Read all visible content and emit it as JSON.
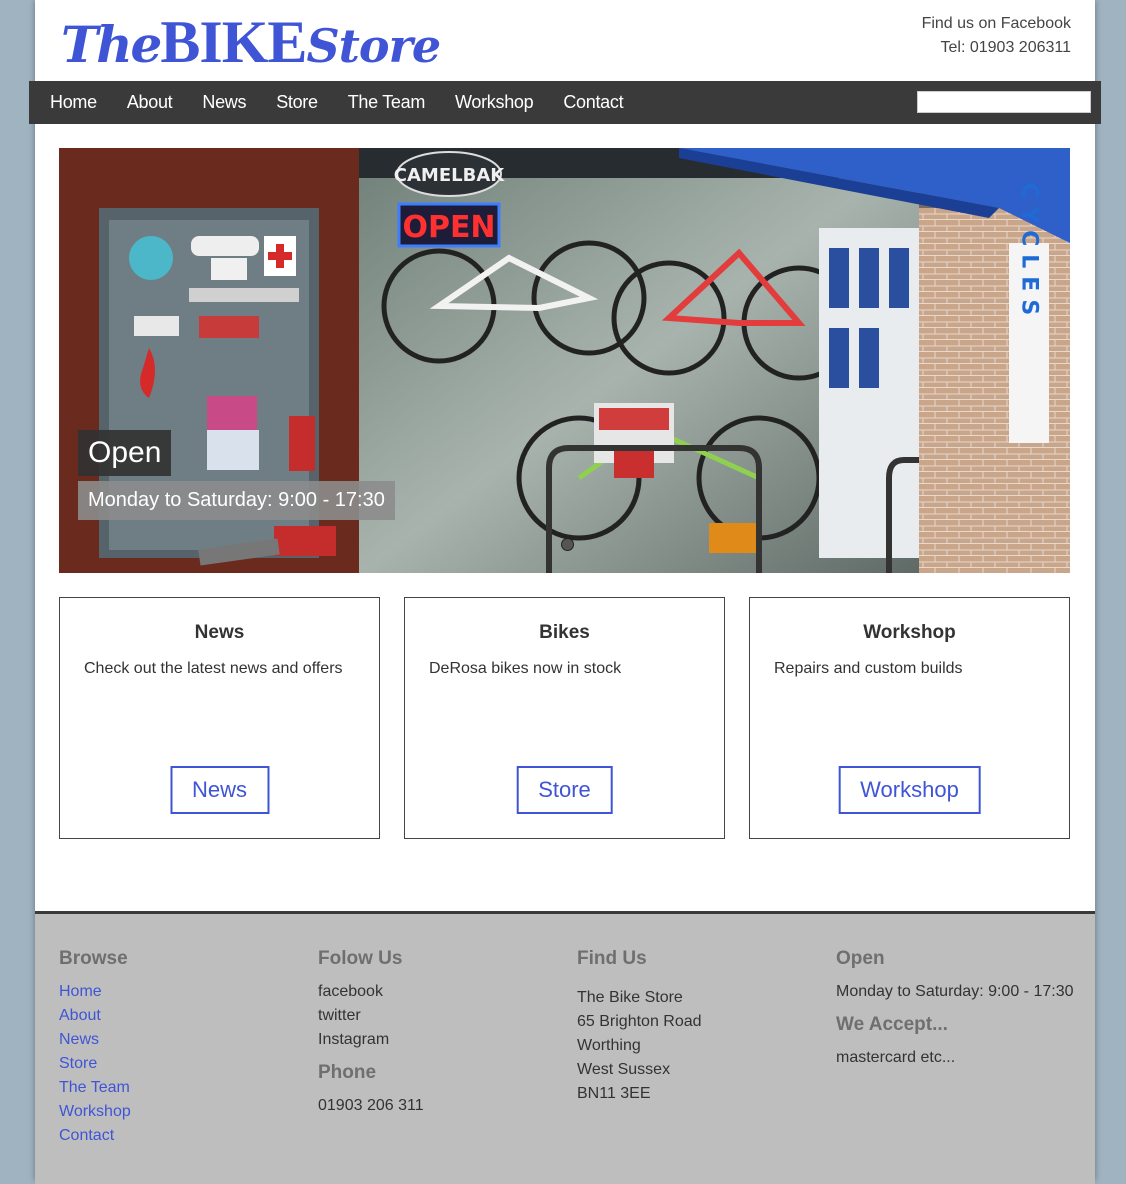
{
  "header": {
    "logo": {
      "the": "The",
      "bike": "BIKE",
      "store": "Store"
    },
    "facebook_link": "Find us on Facebook",
    "phone": "Tel: 01903 206311"
  },
  "nav": {
    "items": [
      "Home",
      "About",
      "News",
      "Store",
      "The Team",
      "Workshop",
      "Contact"
    ],
    "search_value": ""
  },
  "hero": {
    "caption_title": "Open",
    "caption_subtitle": "Monday to Saturday: 9:00 - 17:30",
    "sign_text": "CYCLES",
    "open_sign": "OPEN",
    "brand_sign": "CAMELBAK"
  },
  "cards": [
    {
      "title": "News",
      "text": "Check out the latest news and offers",
      "button": "News"
    },
    {
      "title": "Bikes",
      "text": "DeRosa bikes now in stock",
      "button": "Store"
    },
    {
      "title": "Workshop",
      "text": "Repairs and custom builds",
      "button": "Workshop"
    }
  ],
  "footer": {
    "browse": {
      "heading": "Browse",
      "links": [
        "Home",
        "About",
        "News",
        "Store",
        "The Team",
        "Workshop",
        "Contact"
      ]
    },
    "follow": {
      "heading": "Folow Us",
      "links": [
        "facebook",
        "twitter",
        "Instagram"
      ]
    },
    "phone": {
      "heading": "Phone",
      "value": "01903 206 311"
    },
    "find": {
      "heading": "Find Us",
      "lines": [
        "The Bike Store",
        "65 Brighton Road",
        "Worthing",
        "West Sussex",
        "BN11 3EE"
      ]
    },
    "open": {
      "heading": "Open",
      "hours": "Monday to Saturday: 9:00 - 17:30"
    },
    "accept": {
      "heading": "We Accept...",
      "text": "mastercard etc..."
    }
  },
  "colors": {
    "accent": "#3f55d6",
    "nav_bg": "#3a3a3a",
    "footer_bg": "#bebebe",
    "page_bg": "#9fb3c1"
  }
}
